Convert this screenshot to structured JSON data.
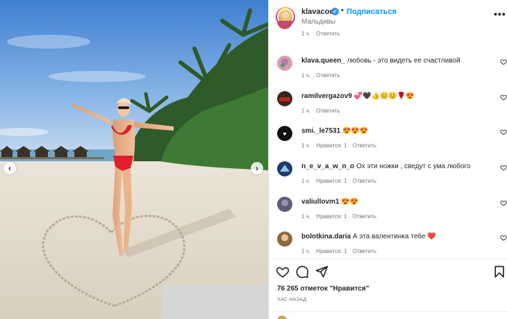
{
  "post": {
    "username": "klavacoca",
    "follow_label": "Подписаться",
    "separator": "•",
    "location": "Мальдивы",
    "more_icon": "more-horizontal-icon"
  },
  "photo": {
    "prev_icon": "‹",
    "next_icon": "›"
  },
  "comments": [
    {
      "username": "",
      "text": "",
      "time": "1 ч.",
      "likes_label": "",
      "reply": "Ответить",
      "avatar_color": "#c4496a"
    },
    {
      "username": "klava.queen_",
      "text": "любовь - это видеть ее счастливой",
      "time": "1 ч.",
      "likes_label": "",
      "reply": "Ответить",
      "avatar_color": "#d99ab5"
    },
    {
      "username": "ramilvergazov9",
      "text": "💞🖤👍😊😊🌹😍",
      "time": "1 ч.",
      "likes_label": "",
      "reply": "Ответить",
      "avatar_color": "#8a2a20"
    },
    {
      "username": "smi._le7531",
      "text": "😍😍😍",
      "time": "1 ч.",
      "likes_label": "Нравится: 1",
      "reply": "Ответить",
      "avatar_color": "#111111"
    },
    {
      "username": "n_e_v_a_w_n_o",
      "text": "Ох эти ножки , сведут с ума любого",
      "time": "1 ч.",
      "likes_label": "Нравится: 1",
      "reply": "Ответить",
      "avatar_color": "#2a4a7a"
    },
    {
      "username": "valiullovm1",
      "text": "😍😍",
      "time": "1 ч.",
      "likes_label": "Нравится: 1",
      "reply": "Ответить",
      "avatar_color": "#4a4a6a"
    },
    {
      "username": "bolotkina.daria",
      "text": "А эта валентинка тебе ❤️",
      "time": "1 ч.",
      "likes_label": "Нравится: 1",
      "reply": "Ответить",
      "avatar_color": "#8a6a3a"
    }
  ],
  "footer": {
    "likes_text": "76 265 отметок \"Нравится\"",
    "time_ago": "ЧАС НАЗАД"
  },
  "colors": {
    "accent": "#0095f6",
    "verified": "#3897f0",
    "heart_red": "#ed4956",
    "text_secondary": "#737373"
  }
}
